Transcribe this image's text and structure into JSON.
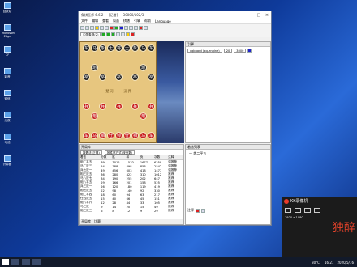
{
  "desktop": {
    "icons": [
      "回收站",
      "Microsoft Edge",
      "CF",
      "影音",
      "微信",
      "无双",
      "电池",
      "计算器"
    ]
  },
  "window": {
    "title": "象棋巫师 6.6.2 — [记谱] — 30000/102/3",
    "menu": [
      "文件",
      "编辑",
      "查看",
      "局面",
      "棋谱",
      "引擎",
      "帮助",
      "Language"
    ],
    "opening_select": "中国象棋(2)",
    "board": {
      "black_top": [
        "车",
        "马",
        "象",
        "士",
        "将",
        "士",
        "象",
        "马",
        "车"
      ],
      "black_cannon": "炮",
      "black_pawn": "卒",
      "red_pawn": "兵",
      "red_cannon": "炮",
      "red_bottom": [
        "车",
        "马",
        "相",
        "仕",
        "帅",
        "仕",
        "相",
        "马",
        "车"
      ],
      "river_left": "楚 河",
      "river_right": "汉 界"
    },
    "engine_panel": {
      "title": "引擎",
      "engine_select": "xqboard (xq-engine)",
      "depth": "20",
      "time": "3000"
    },
    "movelist_panel": {
      "title": "着法列表",
      "items": [
        "一 炮二平五"
      ],
      "comment_label": "注释"
    },
    "library_panel": {
      "title": "开局库",
      "filter1": "按着法(正规)",
      "filter2": "按胜率方式(按分数)",
      "columns": [
        "着法",
        "分数",
        "胜",
        "和",
        "负",
        "次数",
        "注释"
      ],
      "rows": [
        [
          "炮二平五",
          "89",
          "3012",
          "1570",
          "1677",
          "6259",
          "强推荐"
        ],
        [
          "马二进三",
          "54",
          "788",
          "898",
          "856",
          "2542",
          "强推荐"
        ],
        [
          "兵七进一",
          "49",
          "456",
          "603",
          "418",
          "1477",
          "强推荐"
        ],
        [
          "相三进五",
          "36",
          "280",
          "422",
          "310",
          "1012",
          "推荐"
        ],
        [
          "马八进七",
          "34",
          "190",
          "255",
          "202",
          "647",
          "推荐"
        ],
        [
          "炮八平五",
          "29",
          "166",
          "201",
          "158",
          "525",
          "推荐"
        ],
        [
          "兵三进一",
          "26",
          "120",
          "180",
          "119",
          "419",
          "推荐"
        ],
        [
          "相七进五",
          "22",
          "98",
          "140",
          "92",
          "330",
          "推荐"
        ],
        [
          "炮二平四",
          "18",
          "60",
          "94",
          "63",
          "217",
          "推荐"
        ],
        [
          "仕四进五",
          "15",
          "40",
          "66",
          "45",
          "151",
          "推荐"
        ],
        [
          "炮八平六",
          "12",
          "28",
          "44",
          "33",
          "105",
          "推荐"
        ],
        [
          "马二进一",
          "9",
          "14",
          "20",
          "15",
          "49",
          "推荐"
        ],
        [
          "炮二进二",
          "6",
          "8",
          "12",
          "9",
          "29",
          "推荐"
        ]
      ],
      "tabs": [
        "开局库",
        "比赛"
      ]
    },
    "status": "2020-05-16 10:20"
  },
  "taskbar": {
    "time": "16:21",
    "date": "2020/5/16",
    "temp": "30°C"
  },
  "kk": {
    "title": "KK录像机",
    "resolution": "1920 x 1080",
    "brand": "独醉"
  }
}
